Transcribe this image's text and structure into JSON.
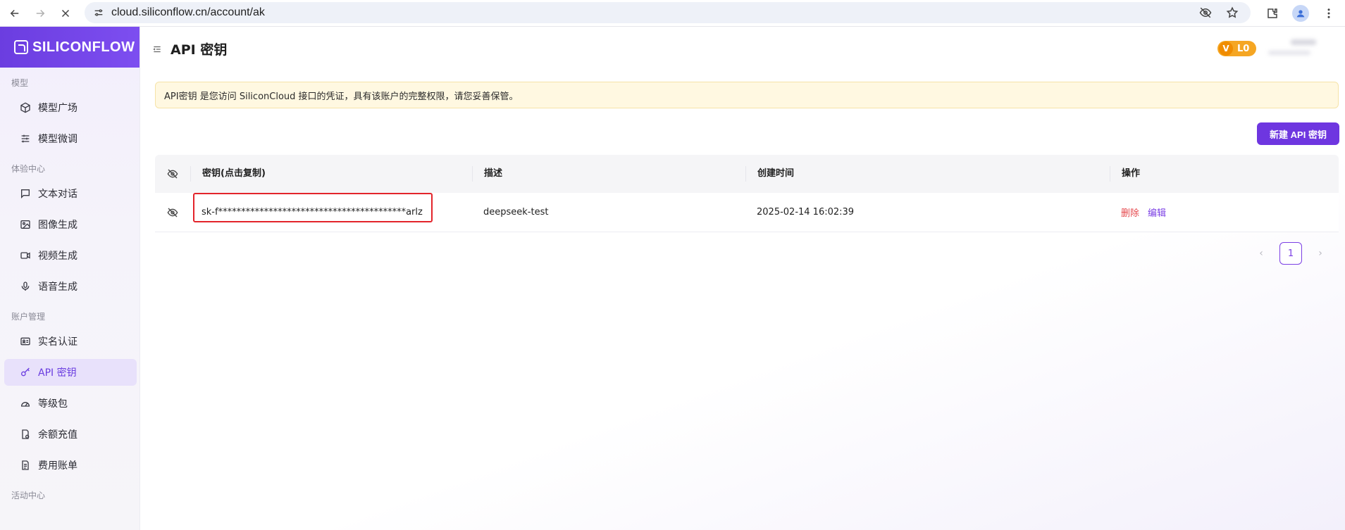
{
  "browser": {
    "url": "cloud.siliconflow.cn/account/ak"
  },
  "app": {
    "logo_text": "SILICONFLOW"
  },
  "sidebar": {
    "sections": [
      {
        "title": "模型",
        "items": [
          {
            "label": "模型广场",
            "icon": "cube-icon"
          },
          {
            "label": "模型微调",
            "icon": "sliders-icon"
          }
        ]
      },
      {
        "title": "体验中心",
        "items": [
          {
            "label": "文本对话",
            "icon": "chat-icon"
          },
          {
            "label": "图像生成",
            "icon": "image-icon"
          },
          {
            "label": "视频生成",
            "icon": "video-icon"
          },
          {
            "label": "语音生成",
            "icon": "mic-icon"
          }
        ]
      },
      {
        "title": "账户管理",
        "items": [
          {
            "label": "实名认证",
            "icon": "id-card-icon"
          },
          {
            "label": "API 密钥",
            "icon": "key-icon",
            "active": true
          },
          {
            "label": "等级包",
            "icon": "gauge-icon"
          },
          {
            "label": "余额充值",
            "icon": "wallet-icon"
          },
          {
            "label": "费用账单",
            "icon": "bill-icon"
          }
        ]
      },
      {
        "title": "活动中心",
        "items": []
      }
    ]
  },
  "header": {
    "title": "API 密钥",
    "level_badge": "L0",
    "level_icon": "V"
  },
  "notice": {
    "text": "API密钥 是您访问 SiliconCloud 接口的凭证，具有该账户的完整权限，请您妥善保管。"
  },
  "actions": {
    "new_key_label": "新建 API 密钥"
  },
  "table": {
    "columns": [
      "密钥(点击复制)",
      "描述",
      "创建时间",
      "操作"
    ],
    "rows": [
      {
        "key": "sk-f*****************************************arlz",
        "description": "deepseek-test",
        "created": "2025-02-14 16:02:39",
        "action_delete": "删除",
        "action_edit": "编辑"
      }
    ]
  },
  "pagination": {
    "current_page": "1",
    "prev": "‹",
    "next": "›"
  },
  "colors": {
    "accent": "#6e36e0",
    "danger": "#e5484d",
    "badge": "#f5a623",
    "notice_bg": "#fff8e1",
    "highlight_box": "#e3242b"
  }
}
